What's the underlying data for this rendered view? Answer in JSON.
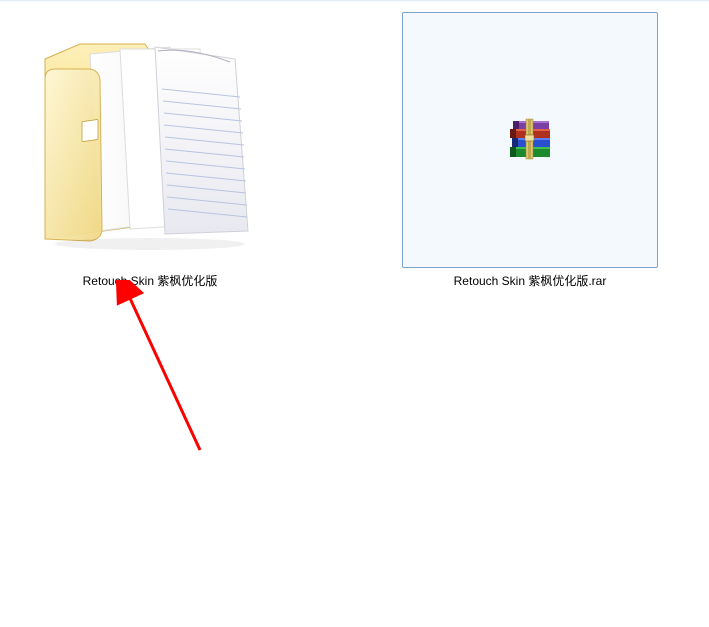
{
  "explorer": {
    "items": [
      {
        "type": "folder",
        "label": "Retouch Skin  紫枫优化版",
        "icon": "folder-with-documents-icon",
        "selected": false
      },
      {
        "type": "rar",
        "label": "Retouch Skin  紫枫优化版.rar",
        "icon": "rar-archive-icon",
        "selected": true
      }
    ]
  },
  "annotation": {
    "arrow_color": "#ff0000"
  }
}
